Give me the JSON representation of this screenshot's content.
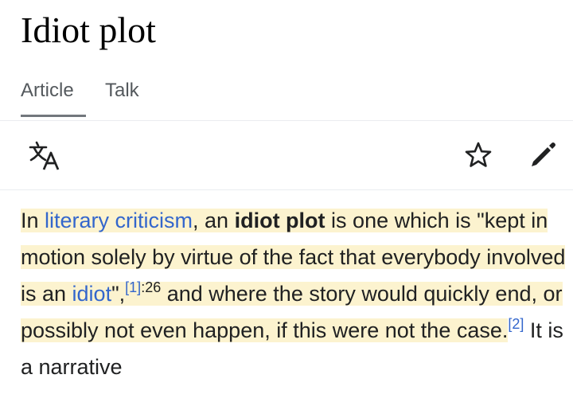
{
  "page": {
    "title": "Idiot plot",
    "tabs": [
      {
        "label": "Article",
        "selected": true
      },
      {
        "label": "Talk",
        "selected": false
      }
    ]
  },
  "toolbar": {
    "icons": [
      "language-icon",
      "star-icon",
      "edit-pencil-icon"
    ]
  },
  "article": {
    "t1": "In ",
    "link1": "literary criticism",
    "t2": ", an ",
    "bold": "idiot plot",
    "t3": " is one which is \"kept in motion solely by virtue of the fact that everybody involved is an ",
    "link2": "idiot",
    "t4": "\",",
    "ref1": "[1]",
    "ref1_page": ":26",
    "t5": " and where the story would quickly end, or possibly not even happen, if this were not the case.",
    "ref2": "[2]",
    "t6": " It is a narrative"
  },
  "colors": {
    "link": "#3366cc",
    "highlight": "#fcf3cf",
    "text": "#202122",
    "tab_text": "#54595d"
  }
}
